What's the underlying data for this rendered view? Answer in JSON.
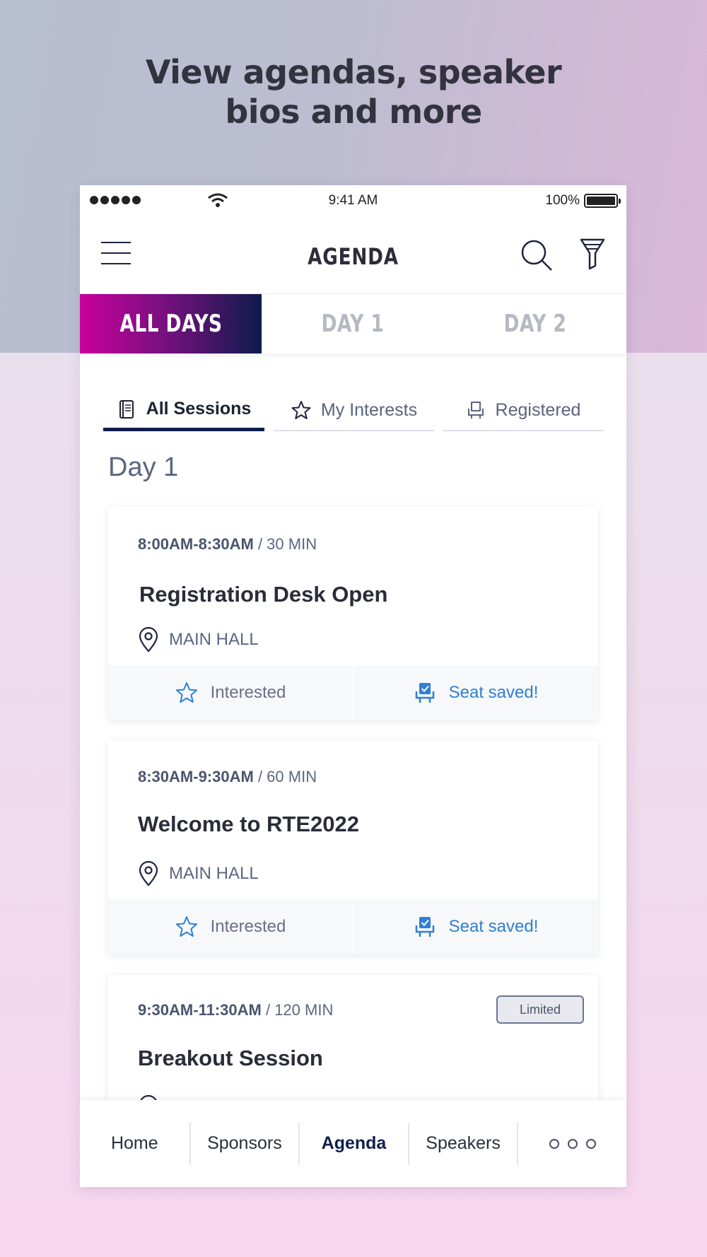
{
  "headline": {
    "line1": "View agendas, speaker",
    "line2": "bios and more"
  },
  "status_bar": {
    "time": "9:41 AM",
    "battery": "100%"
  },
  "header": {
    "title": "AGENDA"
  },
  "day_tabs": [
    {
      "label": "ALL DAYS",
      "active": true
    },
    {
      "label": "DAY 1",
      "active": false
    },
    {
      "label": "DAY 2",
      "active": false
    }
  ],
  "session_tabs": [
    {
      "label": "All Sessions",
      "icon": "book-icon",
      "active": true
    },
    {
      "label": "My Interests",
      "icon": "star-icon",
      "active": false
    },
    {
      "label": "Registered",
      "icon": "seat-icon",
      "active": false
    }
  ],
  "section_title": "Day 1",
  "sessions": [
    {
      "time": "8:00AM-8:30AM",
      "duration": "/ 30 MIN",
      "title": "Registration Desk Open",
      "location": "MAIN HALL",
      "interested_label": "Interested",
      "seat_label": "Seat saved!"
    },
    {
      "time": "8:30AM-9:30AM",
      "duration": "/ 60 MIN",
      "title": "Welcome to RTE2022",
      "location": "MAIN HALL",
      "interested_label": "Interested",
      "seat_label": "Seat saved!"
    },
    {
      "time": "9:30AM-11:30AM",
      "duration": "/ 120 MIN",
      "title": "Breakout Session",
      "badge": "Limited"
    }
  ],
  "bottom_nav": [
    {
      "label": "Home",
      "active": false
    },
    {
      "label": "Sponsors",
      "active": false
    },
    {
      "label": "Agenda",
      "active": true
    },
    {
      "label": "Speakers",
      "active": false
    }
  ],
  "colors": {
    "accent_magenta": "#c8009c",
    "accent_navy": "#0e1b4d",
    "saved_blue": "#2f7fd4"
  }
}
